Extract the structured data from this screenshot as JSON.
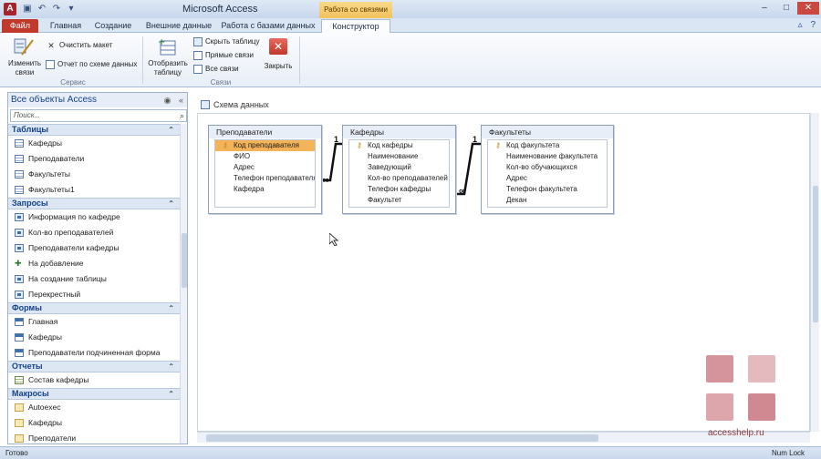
{
  "window": {
    "title": "Microsoft Access",
    "context_tab_group": "Работа со связями"
  },
  "tabs": [
    {
      "label": "Файл"
    },
    {
      "label": "Главная"
    },
    {
      "label": "Создание"
    },
    {
      "label": "Внешние данные"
    },
    {
      "label": "Работа с базами данных"
    },
    {
      "label": "Конструктор"
    }
  ],
  "ribbon": {
    "edit_relations_label_1": "Изменить",
    "edit_relations_label_2": "связи",
    "clear_layout": "Очистить макет",
    "report_by_schema": "Отчет по схеме данных",
    "group_service": "Сервис",
    "show_table_label_1": "Отобразить",
    "show_table_label_2": "таблицу",
    "hide_table": "Скрыть таблицу",
    "direct_relations": "Прямые связи",
    "all_relations": "Все связи",
    "close": "Закрыть",
    "group_relations": "Связи"
  },
  "nav": {
    "header": "Все объекты Access",
    "search_placeholder": "Поиск...",
    "groups": [
      {
        "title": "Таблицы",
        "items": [
          "Кафедры",
          "Преподаватели",
          "Факультеты",
          "Факультеты1"
        ]
      },
      {
        "title": "Запросы",
        "items": [
          "Информация по кафедре",
          "Кол-во преподавателей",
          "Преподаватели кафедры",
          "На добавление",
          "На создание таблицы",
          "Перекрестный"
        ]
      },
      {
        "title": "Формы",
        "items": [
          "Главная",
          "Кафедры",
          "Преподаватели подчиненная форма"
        ]
      },
      {
        "title": "Отчеты",
        "items": [
          "Состав кафедры"
        ]
      },
      {
        "title": "Макросы",
        "items": [
          "Autoexec",
          "Кафедры",
          "Преподатели"
        ]
      }
    ]
  },
  "document": {
    "tab_label": "Схема данных"
  },
  "tables": [
    {
      "title": "Преподаватели",
      "fields": [
        "Код преподавателя",
        "ФИО",
        "Адрес",
        "Телефон преподавателя",
        "Кафедра"
      ]
    },
    {
      "title": "Кафедры",
      "fields": [
        "Код кафедры",
        "Наименование",
        "Заведующий",
        "Кол-во преподавателей",
        "Телефон кафедры",
        "Факультет"
      ]
    },
    {
      "title": "Факультеты",
      "fields": [
        "Код факультета",
        "Наименование факультета",
        "Кол-во обучающихся",
        "Адрес",
        "Телефон факультета",
        "Декан"
      ]
    }
  ],
  "relations": {
    "one": "1",
    "many": "∞"
  },
  "watermark": "accesshelp.ru",
  "status": {
    "left": "Готово",
    "right": "Num Lock"
  },
  "icons": {
    "qat": [
      "save-icon",
      "undo-icon",
      "redo-icon"
    ],
    "close_glyph": "✕",
    "key_glyph": "⚷"
  },
  "colors": {
    "file_tab": "#c0392b",
    "context_tab": "#f2c15a",
    "selected_key_field": "#f4b259",
    "nav_group_title": "#15428b"
  }
}
